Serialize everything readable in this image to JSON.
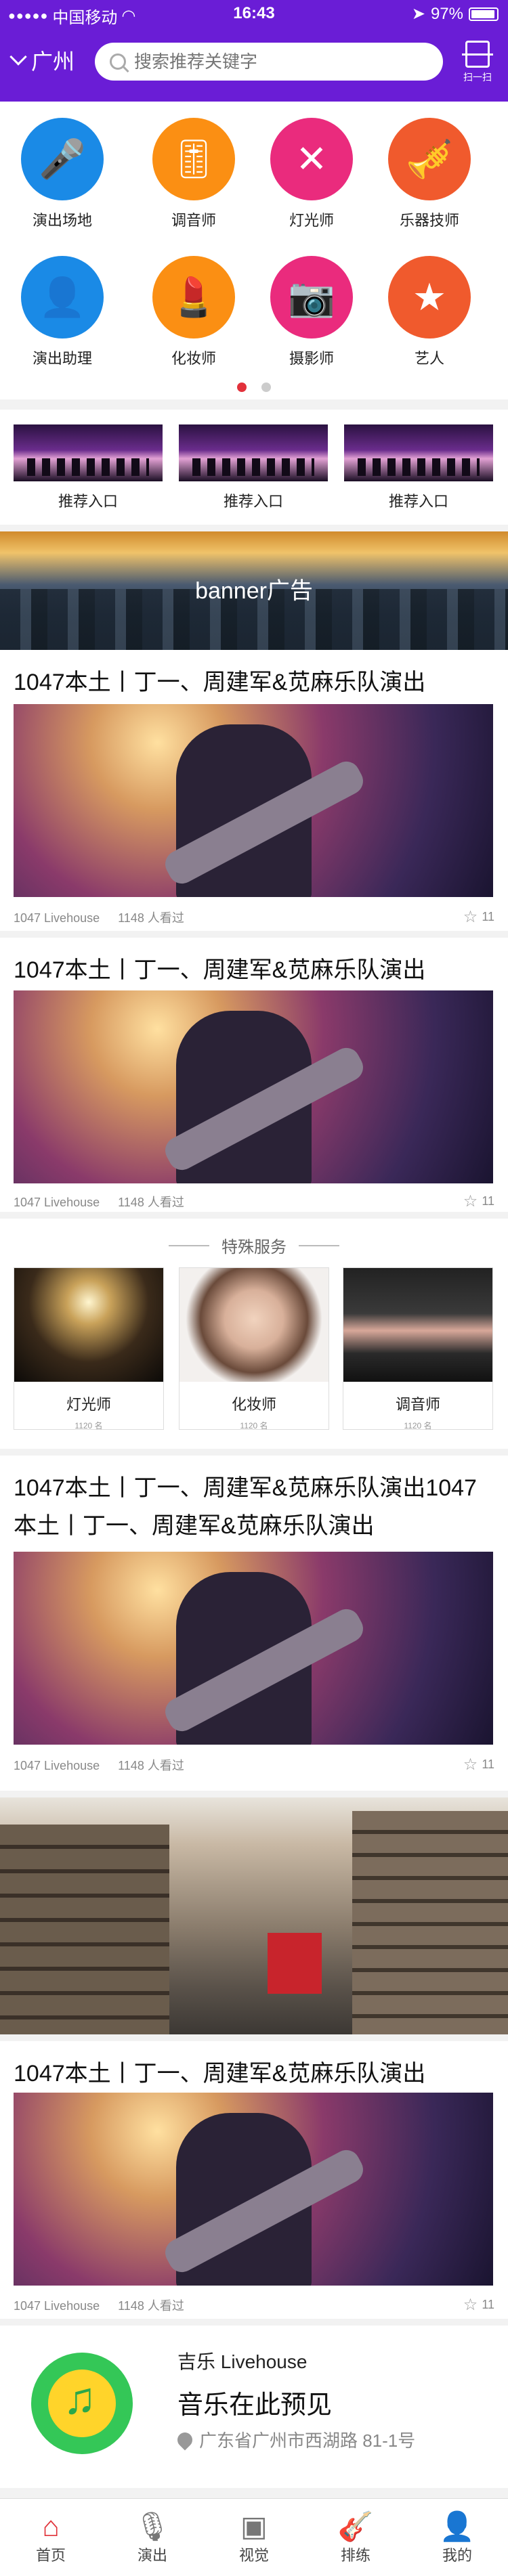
{
  "status_bar": {
    "carrier": "中国移动",
    "time": "16:43",
    "battery": "97%"
  },
  "header": {
    "city": "广州",
    "search_placeholder": "搜索推荐关键字",
    "scan_label": "扫一扫"
  },
  "categories": [
    {
      "label": "演出场地",
      "icon": "microphone-stage-icon",
      "glyph": "🎤",
      "color": "#1a8ae6"
    },
    {
      "label": "调音师",
      "icon": "mixer-sliders-icon",
      "glyph": "🎚",
      "color": "#fb8f13"
    },
    {
      "label": "灯光师",
      "icon": "spotlight-icon",
      "glyph": "✕",
      "color": "#ea2b7d"
    },
    {
      "label": "乐器技师",
      "icon": "trumpet-icon",
      "glyph": "🎺",
      "color": "#f05a2d"
    },
    {
      "label": "演出助理",
      "icon": "assistant-person-icon",
      "glyph": "👤",
      "color": "#1a8ae6"
    },
    {
      "label": "化妆师",
      "icon": "lipstick-icon",
      "glyph": "💄",
      "color": "#fb8f13"
    },
    {
      "label": "摄影师",
      "icon": "camera-icon",
      "glyph": "📷",
      "color": "#ea2b7d"
    },
    {
      "label": "艺人",
      "icon": "artist-star-icon",
      "glyph": "★",
      "color": "#f05a2d"
    }
  ],
  "pager": {
    "pages": 2,
    "active": 0
  },
  "recommend": [
    {
      "label": "推荐入口"
    },
    {
      "label": "推荐入口"
    },
    {
      "label": "推荐入口"
    }
  ],
  "banner": {
    "text": "banner广告"
  },
  "events": [
    {
      "title": "1047本土丨丁一、周建军&苋麻乐队演出",
      "venue": "1047 Livehouse",
      "views": "1148 人看过",
      "stars": "11"
    },
    {
      "title": "1047本土丨丁一、周建军&苋麻乐队演出",
      "venue": "1047 Livehouse",
      "views": "1148 人看过",
      "stars": "11"
    },
    {
      "title": "1047本土丨丁一、周建军&苋麻乐队演出1047本土丨丁一、周建军&苋麻乐队演出",
      "venue": "1047 Livehouse",
      "views": "1148 人看过",
      "stars": "11"
    },
    {
      "title": "1047本土丨丁一、周建军&苋麻乐队演出",
      "venue": "1047 Livehouse",
      "views": "1148 人看过",
      "stars": "11"
    }
  ],
  "special": {
    "heading": "特殊服务",
    "items": [
      {
        "name": "灯光师",
        "count": "1120 名"
      },
      {
        "name": "化妆师",
        "count": "1120 名"
      },
      {
        "name": "调音师",
        "count": "1120 名"
      }
    ]
  },
  "live": {
    "venue": "吉乐 Livehouse",
    "title": "音乐在此预见",
    "address": "广东省广州市西湖路 81-1号"
  },
  "tabs": [
    {
      "label": "首页",
      "icon": "home-icon",
      "glyph": "⌂",
      "active": true
    },
    {
      "label": "演出",
      "icon": "microphone-icon",
      "glyph": "🎙",
      "active": false
    },
    {
      "label": "视觉",
      "icon": "image-icon",
      "glyph": "▣",
      "active": false
    },
    {
      "label": "排练",
      "icon": "guitar-icon",
      "glyph": "🎸",
      "active": false
    },
    {
      "label": "我的",
      "icon": "user-icon",
      "glyph": "👤",
      "active": false
    }
  ],
  "colors": {
    "header": "#6a1dd6",
    "active_tab": "#e0333a",
    "pager_active": "#e2313b"
  }
}
